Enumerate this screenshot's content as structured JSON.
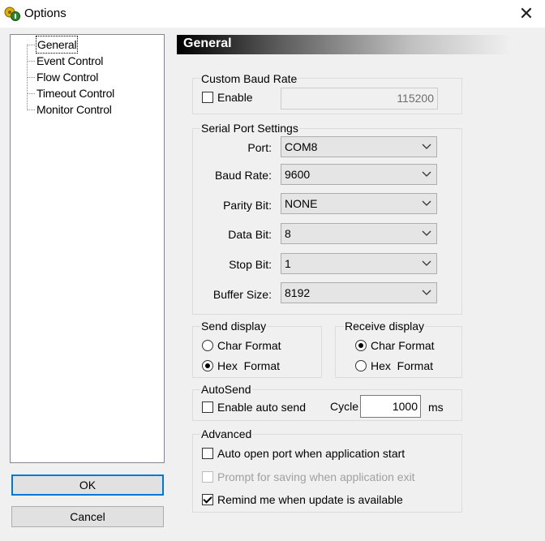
{
  "window": {
    "title": "Options",
    "close_glyph": "✕"
  },
  "tree": {
    "items": [
      {
        "label": "General",
        "selected": true
      },
      {
        "label": "Event Control"
      },
      {
        "label": "Flow Control"
      },
      {
        "label": "Timeout Control"
      },
      {
        "label": "Monitor Control"
      }
    ]
  },
  "buttons": {
    "ok": "OK",
    "cancel": "Cancel"
  },
  "panel": {
    "header": "General",
    "custom_baud": {
      "group": "Custom Baud Rate",
      "enable_label": "Enable",
      "enabled": false,
      "value": "115200"
    },
    "serial": {
      "group": "Serial Port Settings",
      "fields": [
        {
          "label": "Port:",
          "value": "COM8"
        },
        {
          "label": "Baud Rate:",
          "value": "9600"
        },
        {
          "label": "Parity Bit:",
          "value": "NONE"
        },
        {
          "label": "Data Bit:",
          "value": "8"
        },
        {
          "label": "Stop Bit:",
          "value": "1"
        },
        {
          "label": "Buffer Size:",
          "value": "8192"
        }
      ]
    },
    "send_display": {
      "group": "Send display",
      "options": [
        "Char Format",
        "Hex  Format"
      ],
      "selected": 1
    },
    "receive_display": {
      "group": "Receive display",
      "options": [
        "Char Format",
        "Hex  Format"
      ],
      "selected": 0
    },
    "autosend": {
      "group": "AutoSend",
      "enable_label": "Enable auto send",
      "enabled": false,
      "cycle_label": "Cycle",
      "cycle_value": "1000",
      "unit": "ms"
    },
    "advanced": {
      "group": "Advanced",
      "options": [
        {
          "label": "Auto open port when application start",
          "checked": false,
          "disabled": false
        },
        {
          "label": "Prompt for saving when application exit",
          "checked": false,
          "disabled": true
        },
        {
          "label": "Remind me when update is available",
          "checked": true,
          "disabled": false
        }
      ]
    }
  }
}
